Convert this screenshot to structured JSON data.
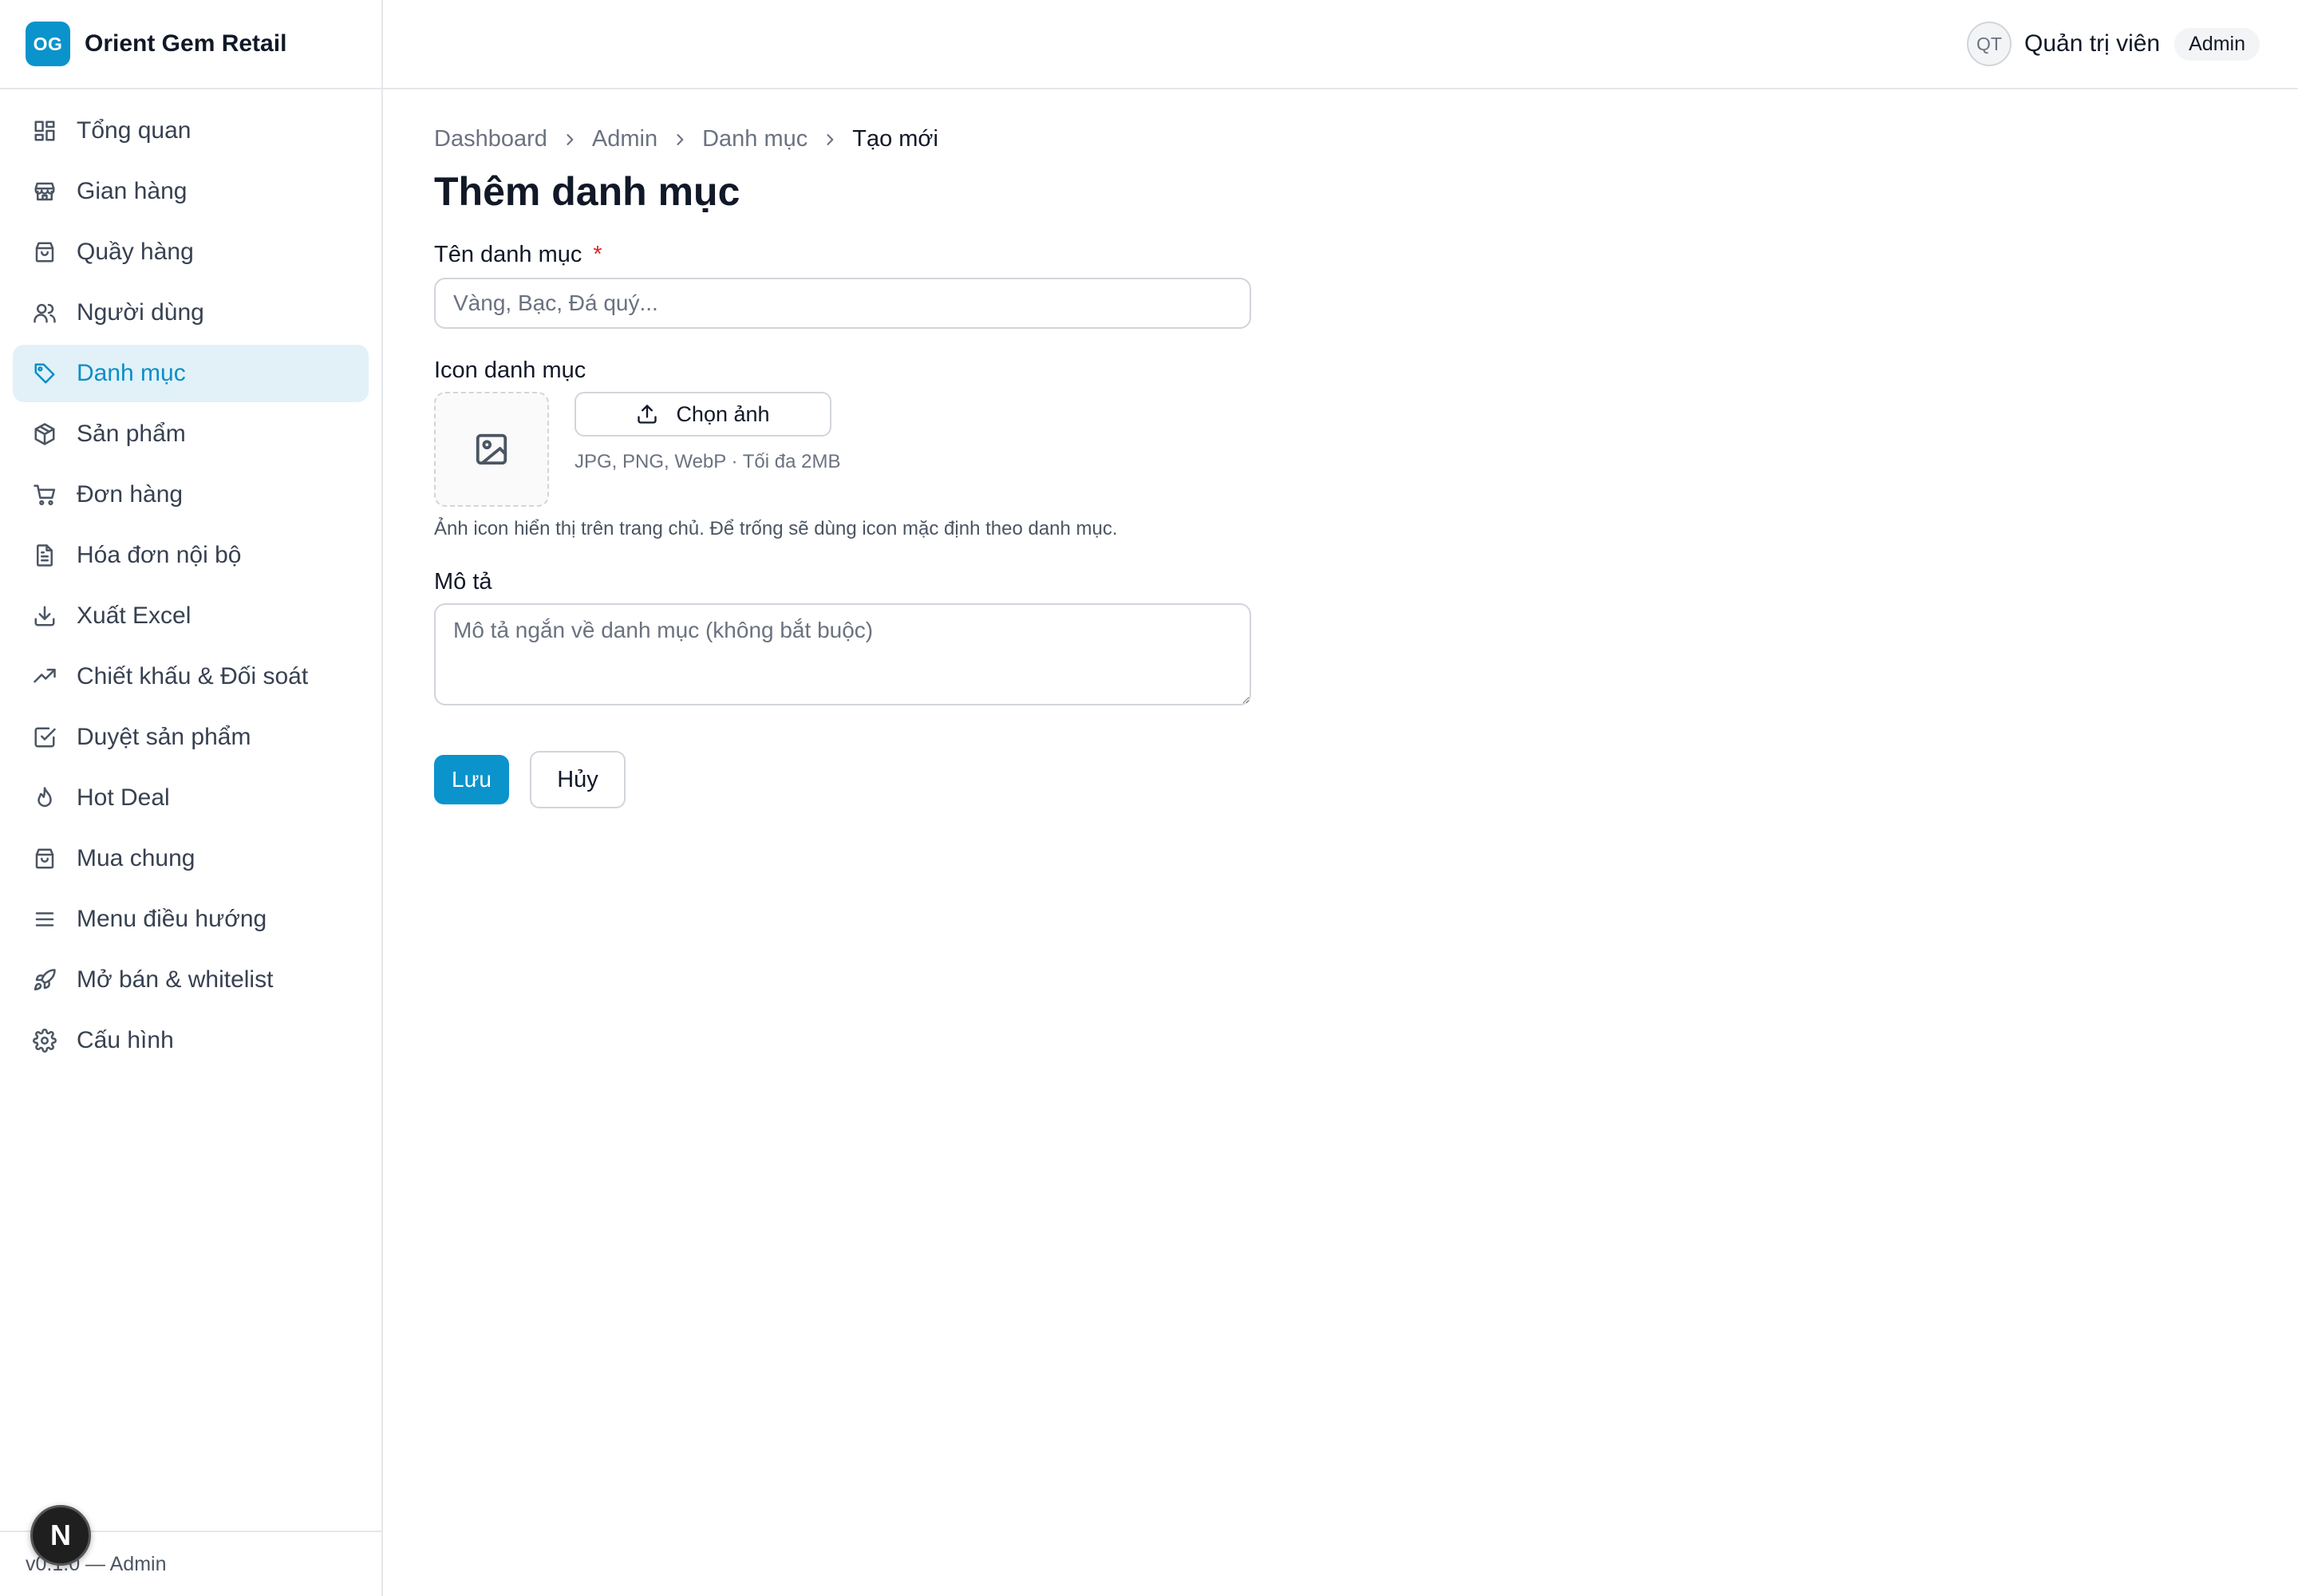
{
  "brand": {
    "logo": "OG",
    "name": "Orient Gem Retail"
  },
  "sidebar": {
    "items": [
      {
        "label": "Tổng quan",
        "icon": "dashboard-icon"
      },
      {
        "label": "Gian hàng",
        "icon": "store-icon"
      },
      {
        "label": "Quầy hàng",
        "icon": "shopping-bag-icon"
      },
      {
        "label": "Người dùng",
        "icon": "users-icon"
      },
      {
        "label": "Danh mục",
        "icon": "tag-icon",
        "active": true
      },
      {
        "label": "Sản phẩm",
        "icon": "package-icon"
      },
      {
        "label": "Đơn hàng",
        "icon": "cart-icon"
      },
      {
        "label": "Hóa đơn nội bộ",
        "icon": "file-text-icon"
      },
      {
        "label": "Xuất Excel",
        "icon": "download-icon"
      },
      {
        "label": "Chiết khấu & Đối soát",
        "icon": "trending-up-icon"
      },
      {
        "label": "Duyệt sản phẩm",
        "icon": "check-square-icon"
      },
      {
        "label": "Hot Deal",
        "icon": "flame-icon"
      },
      {
        "label": "Mua chung",
        "icon": "shopping-bag-icon"
      },
      {
        "label": "Menu điều hướng",
        "icon": "menu-icon"
      },
      {
        "label": "Mở bán & whitelist",
        "icon": "rocket-icon"
      },
      {
        "label": "Cấu hình",
        "icon": "settings-icon"
      }
    ],
    "footer": "v0.1.0 — Admin"
  },
  "header": {
    "avatar": "QT",
    "user_name": "Quản trị viên",
    "role": "Admin"
  },
  "breadcrumb": [
    "Dashboard",
    "Admin",
    "Danh mục",
    "Tạo mới"
  ],
  "page": {
    "title": "Thêm danh mục"
  },
  "form": {
    "name_label": "Tên danh mục",
    "required_mark": "*",
    "name_placeholder": "Vàng, Bạc, Đá quý...",
    "icon_label": "Icon danh mục",
    "upload_button": "Chọn ảnh",
    "upload_hint": "JPG, PNG, WebP · Tối đa 2MB",
    "icon_help": "Ảnh icon hiển thị trên trang chủ. Để trống sẽ dùng icon mặc định theo danh mục.",
    "desc_label": "Mô tả",
    "desc_placeholder": "Mô tả ngắn về danh mục (không bắt buộc)",
    "save_button": "Lưu",
    "cancel_button": "Hủy"
  },
  "dev_badge": "N",
  "colors": {
    "accent": "#0b93cc",
    "active_bg": "#e2f1f8",
    "required": "#dc2626",
    "border": "#e5e7eb"
  }
}
